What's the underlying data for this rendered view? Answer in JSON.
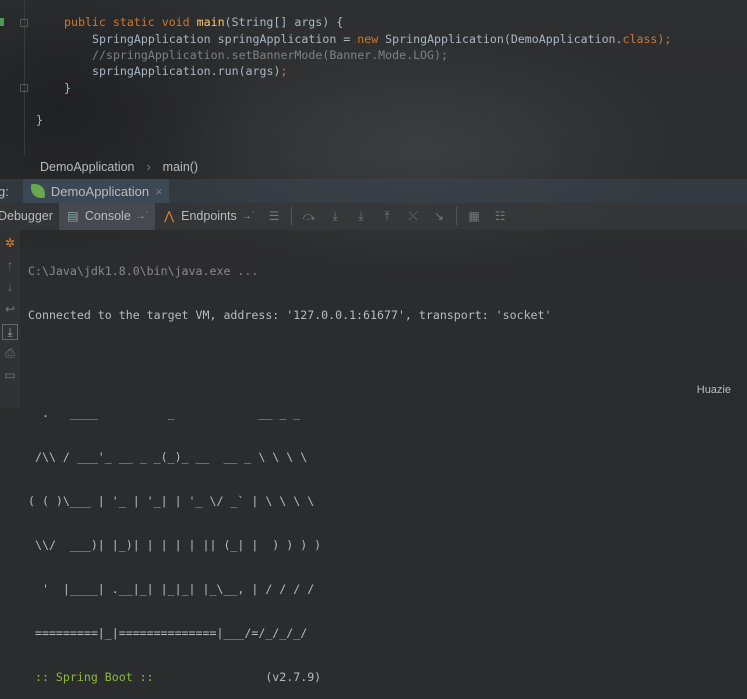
{
  "editor": {
    "lines": [
      {
        "kw1": "public static void ",
        "fn": "main",
        "rest": "(String[] args) {"
      },
      {
        "a": "SpringApplication springApplication = ",
        "kw": "new",
        "b": " SpringApplication(DemoApplication.",
        "kw2": "class",
        "c": ");"
      },
      {
        "comment": "//springApplication.setBannerMode(Banner.Mode.LOG);"
      },
      {
        "a": "springApplication.run(args)",
        "c": ";"
      },
      {
        "a": "}"
      },
      {
        "a": "}"
      }
    ]
  },
  "breadcrumb": {
    "items": [
      "DemoApplication",
      "main()"
    ],
    "sep": "›"
  },
  "runbar": {
    "label": "g:",
    "tab": "DemoApplication",
    "close": "×"
  },
  "toolbar": {
    "debugger": "Debugger",
    "console": "Console",
    "endpoints": "Endpoints",
    "pin": "→˙"
  },
  "console": {
    "lines": [
      "C:\\Java\\jdk1.8.0\\bin\\java.exe ...",
      "Connected to the target VM, address: '127.0.0.1:61677', transport: 'socket'"
    ],
    "banner": [
      "  .   ____          _            __ _ _",
      " /\\\\ / ___'_ __ _ _(_)_ __  __ _ \\ \\ \\ \\",
      "( ( )\\___ | '_ | '_| | '_ \\/ _` | \\ \\ \\ \\",
      " \\\\/  ___)| |_)| | | | | || (_| |  ) ) ) )",
      "  '  |____| .__|_| |_|_| |_\\__, | / / / /",
      " =========|_|==============|___/=/_/_/_/"
    ],
    "boot_label": " :: Spring Boot :: ",
    "boot_version": "               (v2.7.9)"
  },
  "watermark": "Huazie"
}
